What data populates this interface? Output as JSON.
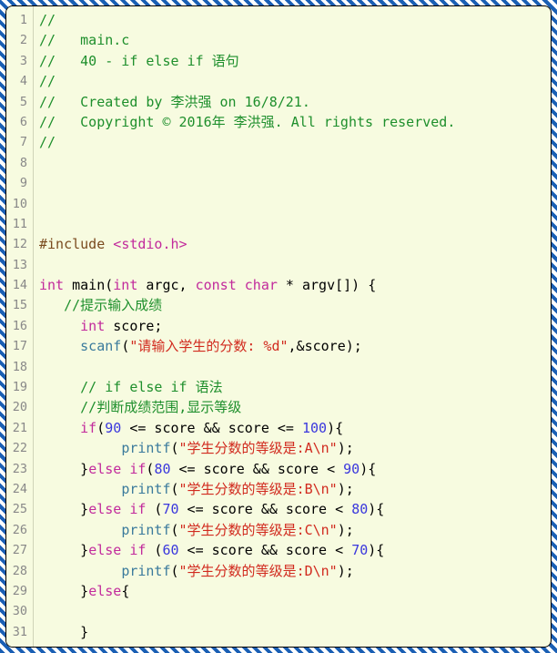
{
  "gutter": {
    "start": 1,
    "end": 31
  },
  "code": {
    "l1": {
      "cmt": "//"
    },
    "l2": {
      "cmt": "//   main.c"
    },
    "l3": {
      "cmt": "//   40 - if else if 语句"
    },
    "l4": {
      "cmt": "//"
    },
    "l5": {
      "cmt": "//   Created by 李洪强 on 16/8/21."
    },
    "l6": {
      "cmt": "//   Copyright © 2016年 李洪强. All rights reserved."
    },
    "l7": {
      "cmt": "//"
    },
    "l12": {
      "pp": "#include ",
      "ang1": "<",
      "hdr": "stdio.h",
      "ang2": ">"
    },
    "l14": {
      "kw1": "int",
      "s1": " main(",
      "kw2": "int",
      "s2": " argc, ",
      "kw3": "const",
      "s3": " ",
      "kw4": "char",
      "s4": " * argv[]) {"
    },
    "l15": {
      "pad": "   ",
      "cmt": "//提示输入成绩"
    },
    "l16": {
      "pad": "     ",
      "kw": "int",
      "s": " score;"
    },
    "l17": {
      "pad": "     ",
      "fn": "scanf",
      "s1": "(",
      "str": "\"请输入学生的分数: %d\"",
      "s2": ",&score);"
    },
    "l19": {
      "pad": "     ",
      "cmt": "// if else if 语法"
    },
    "l20": {
      "pad": "     ",
      "cmt": "//判断成绩范围,显示等级"
    },
    "l21": {
      "pad": "     ",
      "kw": "if",
      "s1": "(",
      "n1": "90",
      "s2": " <= score && score <= ",
      "n2": "100",
      "s3": "){"
    },
    "l22": {
      "pad": "          ",
      "fn": "printf",
      "s1": "(",
      "str": "\"学生分数的等级是:A\\n\"",
      "s2": ");"
    },
    "l23": {
      "pad": "     }",
      "kw1": "else",
      "s1": " ",
      "kw2": "if",
      "s2": "(",
      "n1": "80",
      "s3": " <= score && score < ",
      "n2": "90",
      "s4": "){"
    },
    "l24": {
      "pad": "          ",
      "fn": "printf",
      "s1": "(",
      "str": "\"学生分数的等级是:B\\n\"",
      "s2": ");"
    },
    "l25": {
      "pad": "     }",
      "kw1": "else",
      "s1": " ",
      "kw2": "if",
      "s2": " (",
      "n1": "70",
      "s3": " <= score && score < ",
      "n2": "80",
      "s4": "){"
    },
    "l26": {
      "pad": "          ",
      "fn": "printf",
      "s1": "(",
      "str": "\"学生分数的等级是:C\\n\"",
      "s2": ");"
    },
    "l27": {
      "pad": "     }",
      "kw1": "else",
      "s1": " ",
      "kw2": "if",
      "s2": " (",
      "n1": "60",
      "s3": " <= score && score < ",
      "n2": "70",
      "s4": "){"
    },
    "l28": {
      "pad": "          ",
      "fn": "printf",
      "s1": "(",
      "str": "\"学生分数的等级是:D\\n\"",
      "s2": ");"
    },
    "l29": {
      "pad": "     }",
      "kw": "else",
      "s": "{"
    },
    "l30": {
      "pad": "         "
    },
    "l31": {
      "pad": "     }",
      "s": ""
    }
  }
}
